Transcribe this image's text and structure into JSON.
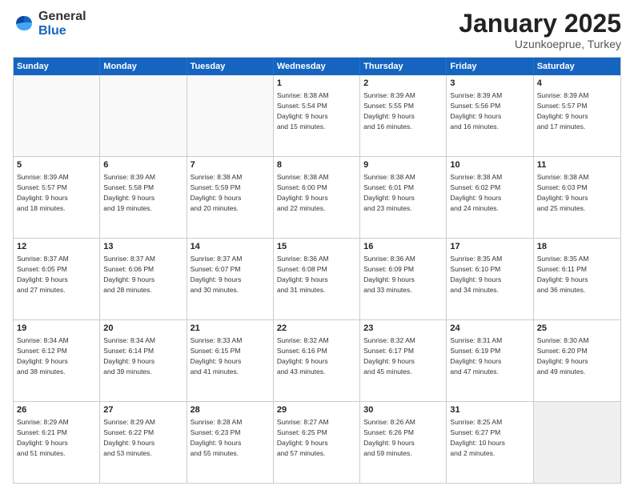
{
  "logo": {
    "general": "General",
    "blue": "Blue"
  },
  "header": {
    "month": "January 2025",
    "location": "Uzunkoeprue, Turkey"
  },
  "weekdays": [
    "Sunday",
    "Monday",
    "Tuesday",
    "Wednesday",
    "Thursday",
    "Friday",
    "Saturday"
  ],
  "rows": [
    [
      {
        "day": "",
        "lines": [],
        "empty": true
      },
      {
        "day": "",
        "lines": [],
        "empty": true
      },
      {
        "day": "",
        "lines": [],
        "empty": true
      },
      {
        "day": "1",
        "lines": [
          "Sunrise: 8:38 AM",
          "Sunset: 5:54 PM",
          "Daylight: 9 hours",
          "and 15 minutes."
        ]
      },
      {
        "day": "2",
        "lines": [
          "Sunrise: 8:39 AM",
          "Sunset: 5:55 PM",
          "Daylight: 9 hours",
          "and 16 minutes."
        ]
      },
      {
        "day": "3",
        "lines": [
          "Sunrise: 8:39 AM",
          "Sunset: 5:56 PM",
          "Daylight: 9 hours",
          "and 16 minutes."
        ]
      },
      {
        "day": "4",
        "lines": [
          "Sunrise: 8:39 AM",
          "Sunset: 5:57 PM",
          "Daylight: 9 hours",
          "and 17 minutes."
        ]
      }
    ],
    [
      {
        "day": "5",
        "lines": [
          "Sunrise: 8:39 AM",
          "Sunset: 5:57 PM",
          "Daylight: 9 hours",
          "and 18 minutes."
        ]
      },
      {
        "day": "6",
        "lines": [
          "Sunrise: 8:39 AM",
          "Sunset: 5:58 PM",
          "Daylight: 9 hours",
          "and 19 minutes."
        ]
      },
      {
        "day": "7",
        "lines": [
          "Sunrise: 8:38 AM",
          "Sunset: 5:59 PM",
          "Daylight: 9 hours",
          "and 20 minutes."
        ]
      },
      {
        "day": "8",
        "lines": [
          "Sunrise: 8:38 AM",
          "Sunset: 6:00 PM",
          "Daylight: 9 hours",
          "and 22 minutes."
        ]
      },
      {
        "day": "9",
        "lines": [
          "Sunrise: 8:38 AM",
          "Sunset: 6:01 PM",
          "Daylight: 9 hours",
          "and 23 minutes."
        ]
      },
      {
        "day": "10",
        "lines": [
          "Sunrise: 8:38 AM",
          "Sunset: 6:02 PM",
          "Daylight: 9 hours",
          "and 24 minutes."
        ]
      },
      {
        "day": "11",
        "lines": [
          "Sunrise: 8:38 AM",
          "Sunset: 6:03 PM",
          "Daylight: 9 hours",
          "and 25 minutes."
        ]
      }
    ],
    [
      {
        "day": "12",
        "lines": [
          "Sunrise: 8:37 AM",
          "Sunset: 6:05 PM",
          "Daylight: 9 hours",
          "and 27 minutes."
        ]
      },
      {
        "day": "13",
        "lines": [
          "Sunrise: 8:37 AM",
          "Sunset: 6:06 PM",
          "Daylight: 9 hours",
          "and 28 minutes."
        ]
      },
      {
        "day": "14",
        "lines": [
          "Sunrise: 8:37 AM",
          "Sunset: 6:07 PM",
          "Daylight: 9 hours",
          "and 30 minutes."
        ]
      },
      {
        "day": "15",
        "lines": [
          "Sunrise: 8:36 AM",
          "Sunset: 6:08 PM",
          "Daylight: 9 hours",
          "and 31 minutes."
        ]
      },
      {
        "day": "16",
        "lines": [
          "Sunrise: 8:36 AM",
          "Sunset: 6:09 PM",
          "Daylight: 9 hours",
          "and 33 minutes."
        ]
      },
      {
        "day": "17",
        "lines": [
          "Sunrise: 8:35 AM",
          "Sunset: 6:10 PM",
          "Daylight: 9 hours",
          "and 34 minutes."
        ]
      },
      {
        "day": "18",
        "lines": [
          "Sunrise: 8:35 AM",
          "Sunset: 6:11 PM",
          "Daylight: 9 hours",
          "and 36 minutes."
        ]
      }
    ],
    [
      {
        "day": "19",
        "lines": [
          "Sunrise: 8:34 AM",
          "Sunset: 6:12 PM",
          "Daylight: 9 hours",
          "and 38 minutes."
        ]
      },
      {
        "day": "20",
        "lines": [
          "Sunrise: 8:34 AM",
          "Sunset: 6:14 PM",
          "Daylight: 9 hours",
          "and 39 minutes."
        ]
      },
      {
        "day": "21",
        "lines": [
          "Sunrise: 8:33 AM",
          "Sunset: 6:15 PM",
          "Daylight: 9 hours",
          "and 41 minutes."
        ]
      },
      {
        "day": "22",
        "lines": [
          "Sunrise: 8:32 AM",
          "Sunset: 6:16 PM",
          "Daylight: 9 hours",
          "and 43 minutes."
        ]
      },
      {
        "day": "23",
        "lines": [
          "Sunrise: 8:32 AM",
          "Sunset: 6:17 PM",
          "Daylight: 9 hours",
          "and 45 minutes."
        ]
      },
      {
        "day": "24",
        "lines": [
          "Sunrise: 8:31 AM",
          "Sunset: 6:19 PM",
          "Daylight: 9 hours",
          "and 47 minutes."
        ]
      },
      {
        "day": "25",
        "lines": [
          "Sunrise: 8:30 AM",
          "Sunset: 6:20 PM",
          "Daylight: 9 hours",
          "and 49 minutes."
        ]
      }
    ],
    [
      {
        "day": "26",
        "lines": [
          "Sunrise: 8:29 AM",
          "Sunset: 6:21 PM",
          "Daylight: 9 hours",
          "and 51 minutes."
        ]
      },
      {
        "day": "27",
        "lines": [
          "Sunrise: 8:29 AM",
          "Sunset: 6:22 PM",
          "Daylight: 9 hours",
          "and 53 minutes."
        ]
      },
      {
        "day": "28",
        "lines": [
          "Sunrise: 8:28 AM",
          "Sunset: 6:23 PM",
          "Daylight: 9 hours",
          "and 55 minutes."
        ]
      },
      {
        "day": "29",
        "lines": [
          "Sunrise: 8:27 AM",
          "Sunset: 6:25 PM",
          "Daylight: 9 hours",
          "and 57 minutes."
        ]
      },
      {
        "day": "30",
        "lines": [
          "Sunrise: 8:26 AM",
          "Sunset: 6:26 PM",
          "Daylight: 9 hours",
          "and 59 minutes."
        ]
      },
      {
        "day": "31",
        "lines": [
          "Sunrise: 8:25 AM",
          "Sunset: 6:27 PM",
          "Daylight: 10 hours",
          "and 2 minutes."
        ]
      },
      {
        "day": "",
        "lines": [],
        "empty": true,
        "shaded": true
      }
    ]
  ]
}
